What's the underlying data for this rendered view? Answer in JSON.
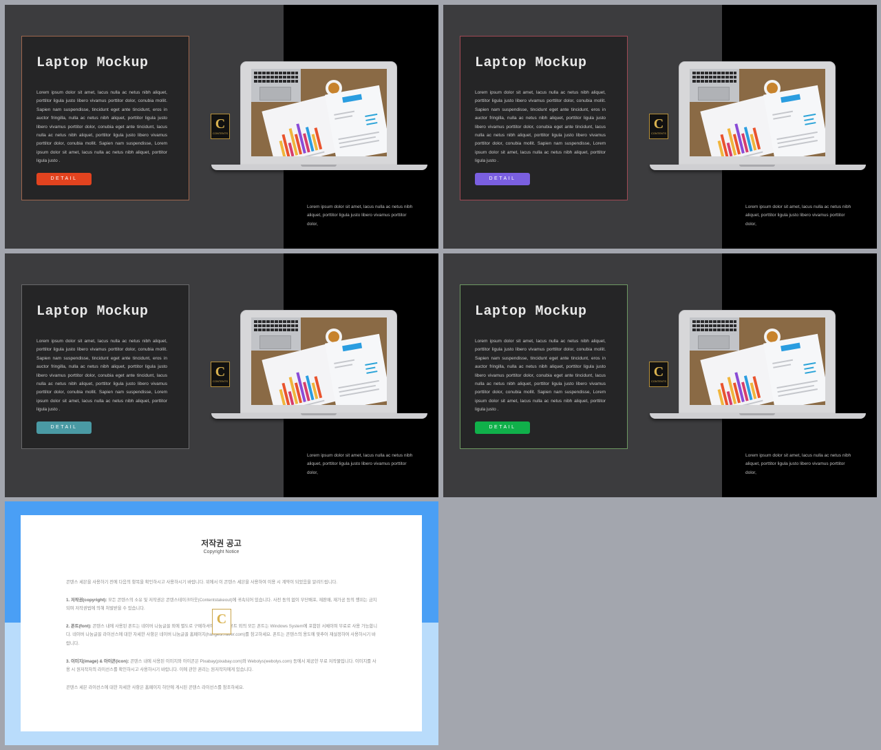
{
  "slides": [
    {
      "id": "slide-1",
      "title": "Laptop Mockup",
      "body": "Lorem ipsum dolor sit amet, lacus nulla ac netus nibh aliquet, porttitor ligula justo libero vivamus porttitor dolor, conubia mollit. Sapien nam suspendisse, tincidunt eget ante tincidunt, eros in auctor fringilla, nulla ac netus nibh aliquet, porttitor ligula justo libero vivamus porttitor dolor, conubia eget ante tincidunt, lacus nulla ac netus nibh aliquet, porttitor ligula justo libero vivamus porttitor dolor, conubia mollit. Sapien nam suspendisse, Lorem ipsum dolor sit amet, lacus nulla ac netus nibh aliquet, porttitor ligula justo .",
      "button_label": "DETAIL",
      "accent_color": "#e2431f",
      "border_color": "#a0684f",
      "side_text": "Lorem ipsum dolor sit amet, lacus nulla ac netus nibh aliquet, porttitor ligula justo libero vivamus porttitor dolor,"
    },
    {
      "id": "slide-2",
      "title": "Laptop Mockup",
      "body": "Lorem ipsum dolor sit amet, lacus nulla ac netus nibh aliquet, porttitor ligula justo libero vivamus porttitor dolor, conubia mollit. Sapien nam suspendisse, tincidunt eget ante tincidunt, eros in auctor fringilla, nulla ac netus nibh aliquet, porttitor ligula justo libero vivamus porttitor dolor, conubia eget ante tincidunt, lacus nulla ac netus nibh aliquet, porttitor ligula justo libero vivamus porttitor dolor, conubia mollit. Sapien nam suspendisse, Lorem ipsum dolor sit amet, lacus nulla ac netus nibh aliquet, porttitor ligula justo .",
      "button_label": "DETAIL",
      "accent_color": "#7a5fe0",
      "border_color": "#a24a55",
      "side_text": "Lorem ipsum dolor sit amet, lacus nulla ac netus nibh aliquet, porttitor ligula justo libero vivamus porttitor dolor,"
    },
    {
      "id": "slide-3",
      "title": "Laptop Mockup",
      "body": "Lorem ipsum dolor sit amet, lacus nulla ac netus nibh aliquet, porttitor ligula justo libero vivamus porttitor dolor, conubia mollit. Sapien nam suspendisse, tincidunt eget ante tincidunt, eros in auctor fringilla, nulla ac netus nibh aliquet, porttitor ligula justo libero vivamus porttitor dolor, conubia eget ante tincidunt, lacus nulla ac netus nibh aliquet, porttitor ligula justo libero vivamus porttitor dolor, conubia mollit. Sapien nam suspendisse, Lorem ipsum dolor sit amet, lacus nulla ac netus nibh aliquet, porttitor ligula justo .",
      "button_label": "DETAIL",
      "accent_color": "#4a9aa4",
      "border_color": "#6a6a6c",
      "side_text": "Lorem ipsum dolor sit amet, lacus nulla ac netus nibh aliquet, porttitor ligula justo libero vivamus porttitor dolor,"
    },
    {
      "id": "slide-4",
      "title": "Laptop Mockup",
      "body": "Lorem ipsum dolor sit amet, lacus nulla ac netus nibh aliquet, porttitor ligula justo libero vivamus porttitor dolor, conubia mollit. Sapien nam suspendisse, tincidunt eget ante tincidunt, eros in auctor fringilla, nulla ac netus nibh aliquet, porttitor ligula justo libero vivamus porttitor dolor, conubia eget ante tincidunt, lacus nulla ac netus nibh aliquet, porttitor ligula justo libero vivamus porttitor dolor, conubia mollit. Sapien nam suspendisse, Lorem ipsum dolor sit amet, lacus nulla ac netus nibh aliquet, porttitor ligula justo .",
      "button_label": "DETAIL",
      "accent_color": "#10b04a",
      "border_color": "#6f9a63",
      "side_text": "Lorem ipsum dolor sit amet, lacus nulla ac netus nibh aliquet, porttitor ligula justo libero vivamus porttitor dolor,"
    }
  ],
  "logo": {
    "letter": "C",
    "caption": "CONTENTS",
    "icon": "contents-logo-icon",
    "gold": "#d9b24f"
  },
  "notice": {
    "title": "저작권 공고",
    "subtitle": "Copyright Notice",
    "paragraphs": [
      {
        "heading": "",
        "text": "콘텐스 세븐을 사용하기 전에 다음의 항목을 확인하시고 사용하시기 바랍니다. 위에서 이 콘텐스 세븐을 사용하여 이용 시 계약이 되었음을 알려드립니다."
      },
      {
        "heading": "1. 저작권(copyright):",
        "text": "모든 콘텐스의 소유 및 저작권은 콘텐스테이크아웃(Contentstakeout)에 귀속되어 있습니다. 사전 동의 없이 무단배포, 재판매, 재가공 등의 행위는 금지되며 저작권법에 의해 처벌받을 수 있습니다."
      },
      {
        "heading": "2. 폰트(font):",
        "text": "콘텐스 내에 사용된 폰트는 네이버 나눔글꼴 외에 별도로 구매하셔야 합니다. 폰트 외의 모든 폰트는 Windows System에 포함된 서체이며 무료로 사용 가능합니다. 네이버 나눔글꼴 라이선스에 대한 자세한 사항은 네이버 나눔글꼴 홈페이지(hangeul.naver.com)를 참고하세요. 폰트는 콘텐스의 용도에 맞추어 재설정하여 사용하시기 바랍니다."
      },
      {
        "heading": "3. 이미지(image) & 아이콘(icon):",
        "text": "콘텐스 내에 사용된 이미지와 아이콘은 Pixabay(pixabay.com)와 Webolys(webolys.com) 등에서 제공한 무료 저작물입니다. 이미지를 사용 시 원저작자의 라이선스를 확인하시고 사용하시기 바랍니다. 이에 관한 권리는 원저작자에게 있습니다."
      },
      {
        "heading": "",
        "text": "콘텐스 세븐 라이선스에 대한 자세한 사항은 홈페이지 하단에 게시된 콘텐스 라이선스를 참조하세요."
      }
    ]
  }
}
